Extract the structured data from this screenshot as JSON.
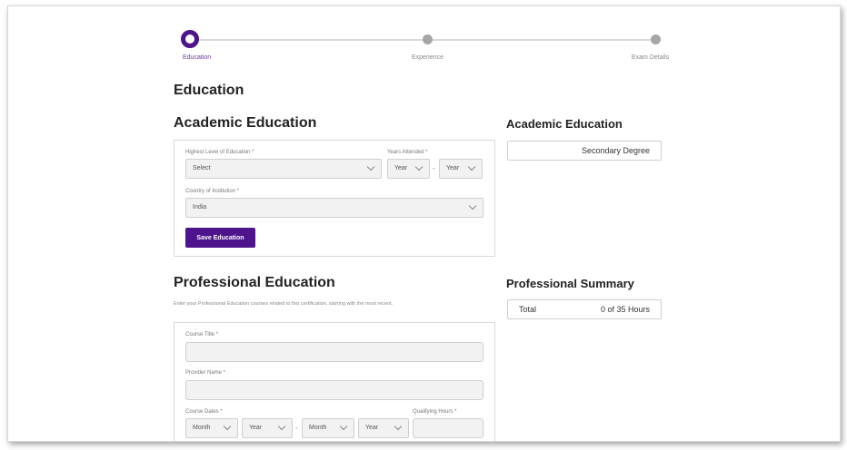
{
  "stepper": {
    "steps": [
      {
        "label": "Education",
        "state": "active"
      },
      {
        "label": "Experience",
        "state": "inactive"
      },
      {
        "label": "Exam Details",
        "state": "inactive"
      }
    ]
  },
  "page_title": "Education",
  "academic": {
    "title": "Academic Education",
    "highest_level_label": "Highest Level of Education *",
    "highest_level_value": "Select",
    "years_attended_label": "Years Attended *",
    "year_from_value": "Year",
    "year_to_value": "Year",
    "year_separator": "-",
    "country_label": "Country of Institution *",
    "country_value": "India",
    "save_button": "Save Education"
  },
  "academic_summary": {
    "title": "Academic Education",
    "value": "Secondary Degree"
  },
  "professional": {
    "title": "Professional Education",
    "helper": "Enter your Professional Education courses related to this certification, starting with the most recent.",
    "course_title_label": "Course Title *",
    "provider_name_label": "Provider Name *",
    "course_dates_label": "Course Dates *",
    "qualifying_hours_label": "Qualifying Hours *",
    "start_month": "Month",
    "start_year": "Year",
    "end_month": "Month",
    "end_year": "Year",
    "date_separator": "-"
  },
  "professional_summary": {
    "title": "Professional Summary",
    "total_label": "Total",
    "total_value": "0 of 35 Hours"
  },
  "colors": {
    "accent": "#4d148c",
    "inactive_dot": "#a6a6a6"
  }
}
